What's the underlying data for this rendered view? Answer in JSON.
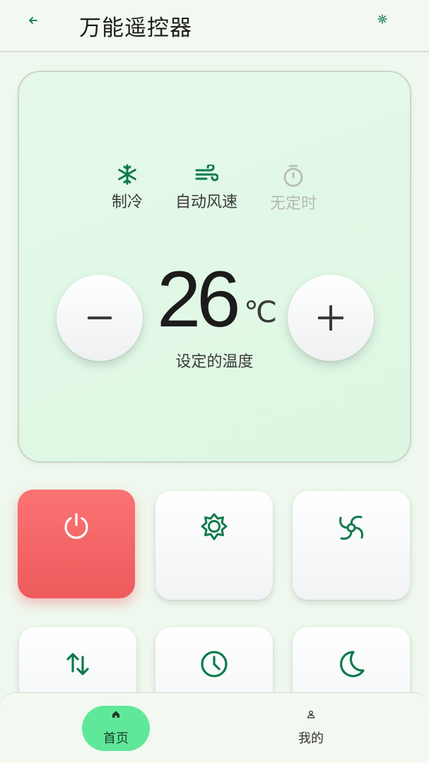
{
  "header": {
    "title": "万能遥控器",
    "back_icon": "arrow-left-icon",
    "settings_icon": "gear-icon"
  },
  "display": {
    "status": [
      {
        "icon": "snowflake-icon",
        "label": "制冷",
        "active": true
      },
      {
        "icon": "wind-icon",
        "label": "自动风速",
        "active": true
      },
      {
        "icon": "timer-icon",
        "label": "无定时",
        "active": false
      }
    ],
    "temperature": "26",
    "unit": "℃",
    "caption": "设定的温度",
    "minus_icon": "minus-icon",
    "plus_icon": "plus-icon"
  },
  "tiles": [
    {
      "icon": "power-icon"
    },
    {
      "icon": "sun-gear-icon"
    },
    {
      "icon": "fan-icon"
    },
    {
      "icon": "swing-arrows-icon"
    },
    {
      "icon": "clock-icon"
    },
    {
      "icon": "moon-icon"
    }
  ],
  "nav": {
    "items": [
      {
        "icon": "home-icon",
        "label": "首页",
        "active": true
      },
      {
        "icon": "person-icon",
        "label": "我的",
        "active": false
      }
    ]
  },
  "colors": {
    "accent": "#0d7a4a",
    "power": "#f06466",
    "nav_active": "#5fe89a",
    "background": "#eff8ee"
  }
}
